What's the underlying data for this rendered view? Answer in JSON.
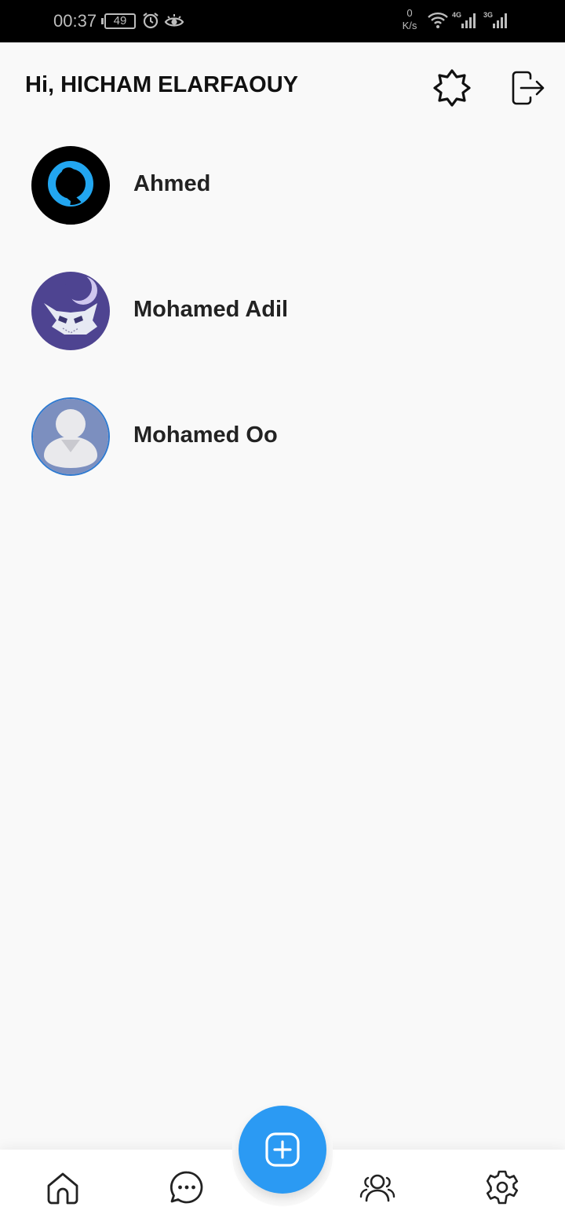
{
  "status_bar": {
    "time": "00:37",
    "battery": "49",
    "speed_value": "0",
    "speed_unit": "K/s",
    "network_1": "4G",
    "network_2": "3G"
  },
  "header": {
    "greeting": "Hi, HICHAM ELARFAOUY",
    "icons": [
      "theme-toggle-icon",
      "logout-icon"
    ]
  },
  "contacts": [
    {
      "name": "Ahmed",
      "avatar": "silhouette-blue-ring"
    },
    {
      "name": "Mohamed Adil",
      "avatar": "purple-mask"
    },
    {
      "name": "Mohamed Oo",
      "avatar": "default-user"
    }
  ],
  "bottom_nav": {
    "items": [
      "home-icon",
      "chat-icon",
      "add-icon",
      "group-icon",
      "settings-icon"
    ]
  },
  "colors": {
    "accent": "#2b9af3",
    "background": "#f9f9f9",
    "text": "#111111"
  }
}
